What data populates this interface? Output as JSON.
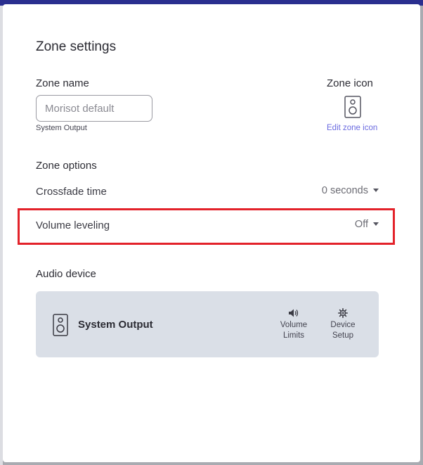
{
  "dialog": {
    "title": "Zone settings",
    "zone_name": {
      "label": "Zone name",
      "placeholder": "Morisot default",
      "value": "",
      "sub_label": "System Output"
    },
    "zone_icon": {
      "label": "Zone icon",
      "icon": "speaker-icon",
      "edit_link": "Edit zone icon"
    },
    "zone_options": {
      "label": "Zone options",
      "crossfade": {
        "label": "Crossfade time",
        "value": "0 seconds"
      },
      "volume_leveling": {
        "label": "Volume leveling",
        "value": "Off"
      }
    },
    "audio_device": {
      "label": "Audio device",
      "device": {
        "icon": "speaker-icon",
        "name": "System Output",
        "buttons": [
          {
            "line1": "Volume",
            "line2": "Limits",
            "icon": "volume-icon"
          },
          {
            "line1": "Device",
            "line2": "Setup",
            "icon": "gear-icon"
          }
        ]
      }
    }
  },
  "colors": {
    "accent_link": "#6a6ae0",
    "highlight": "#e3222a",
    "top_bar": "#2a2f8f",
    "device_card": "#dadfe7"
  }
}
